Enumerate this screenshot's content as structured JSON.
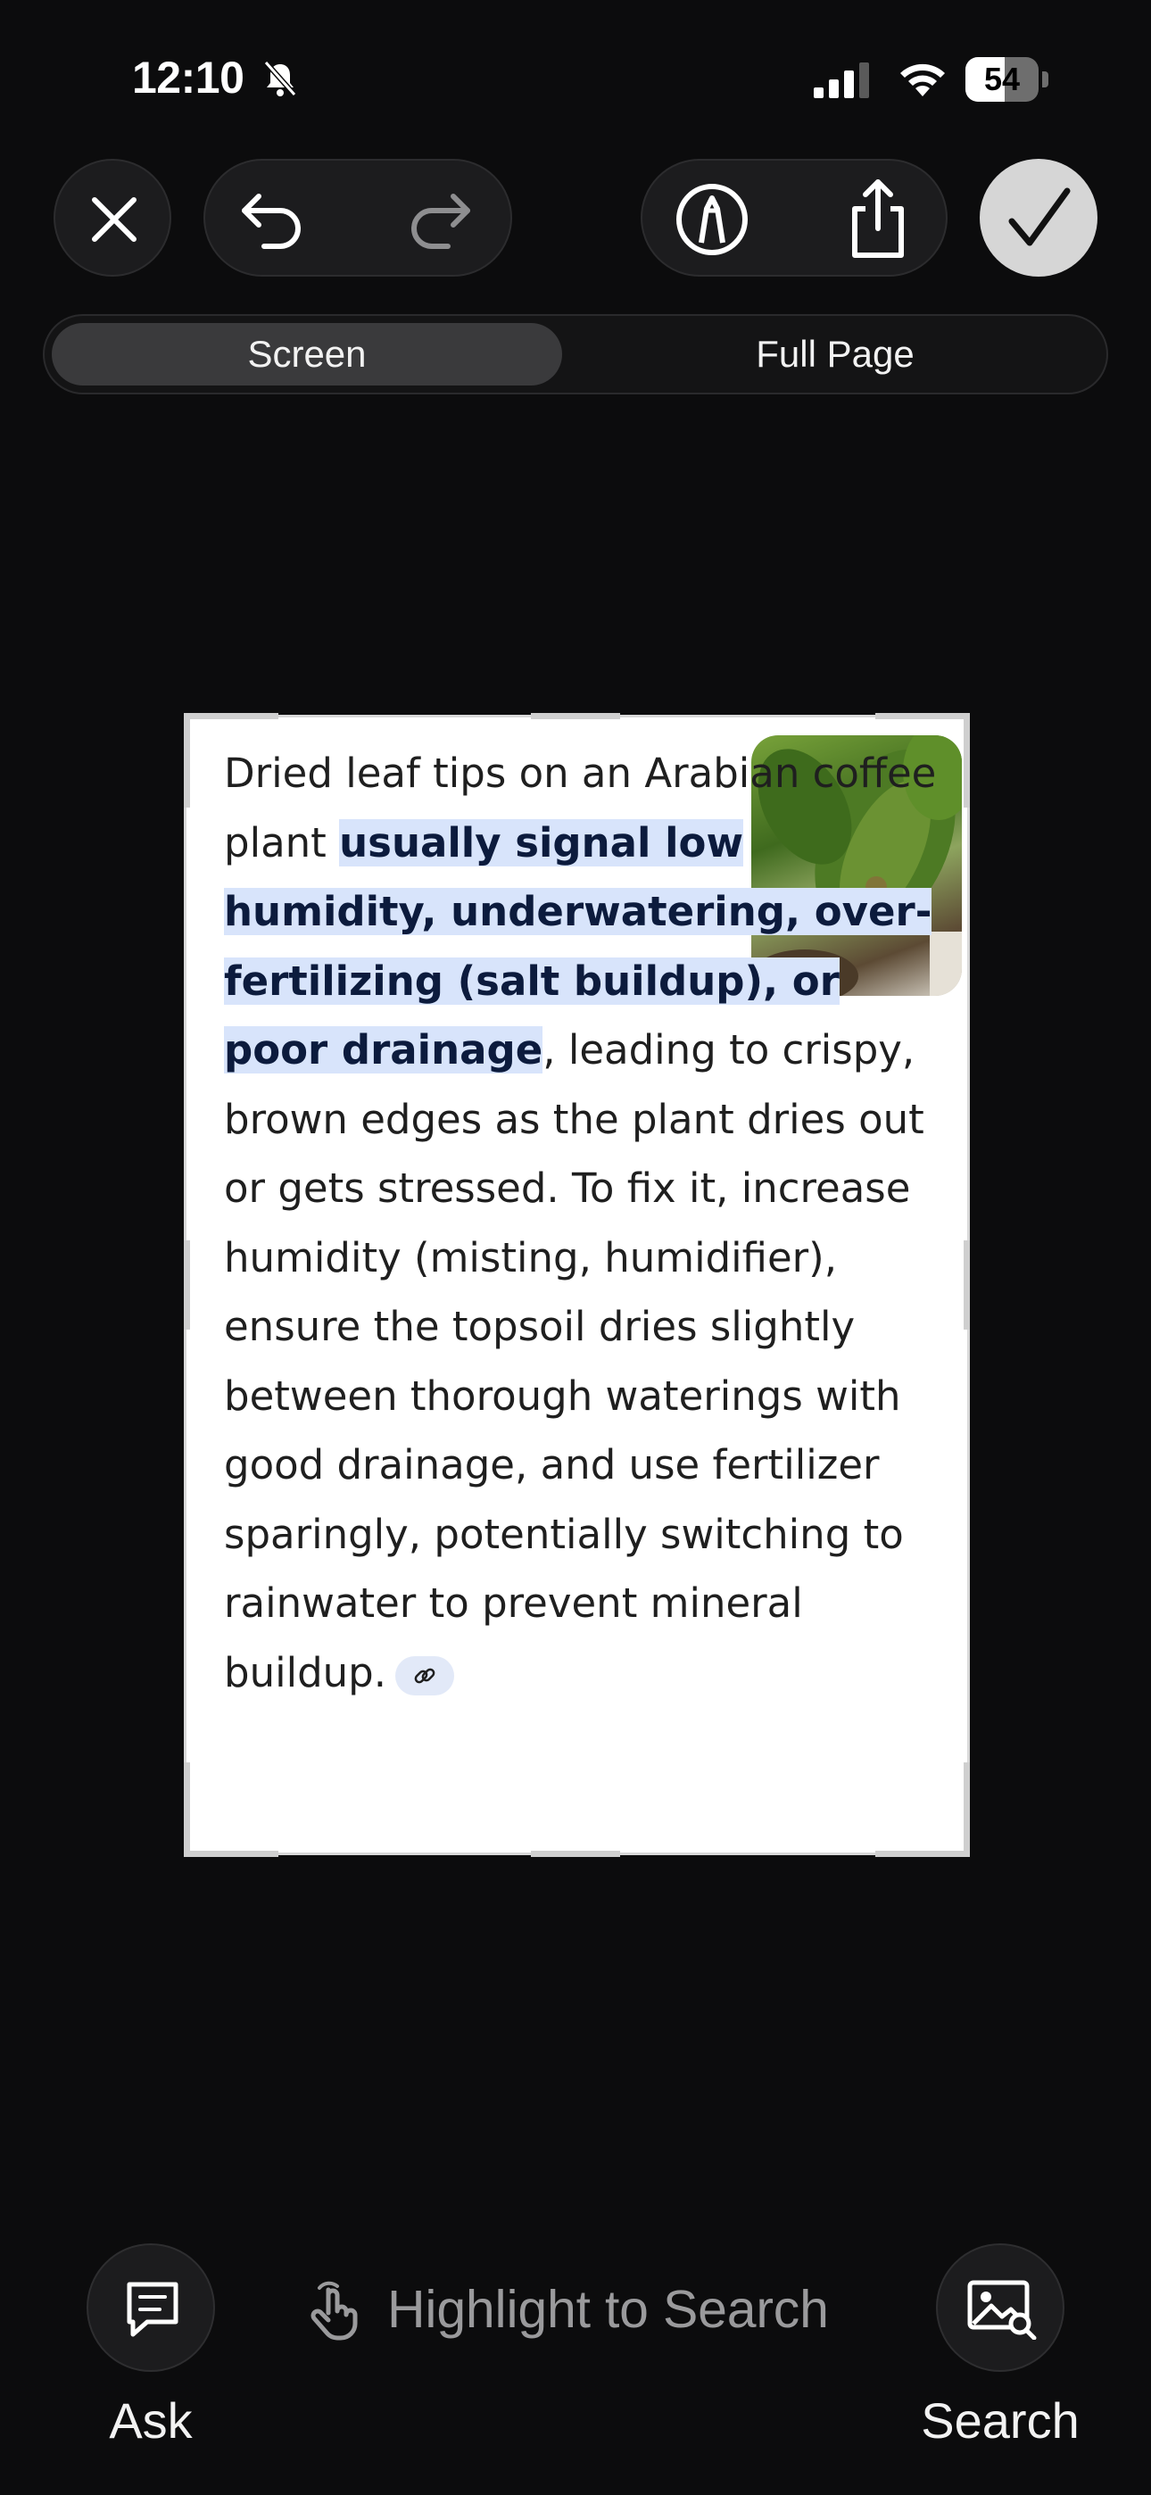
{
  "status_bar": {
    "time": "12:10",
    "battery_percent": "54",
    "battery_level": 0.54
  },
  "toolbar": {
    "close_icon": "close-icon",
    "undo_icon": "undo-icon",
    "redo_icon": "redo-icon",
    "markup_icon": "markup-pen-icon",
    "share_icon": "share-icon",
    "done_icon": "checkmark-icon"
  },
  "segmented": {
    "screen_label": "Screen",
    "full_page_label": "Full Page",
    "selected": "Screen"
  },
  "capture": {
    "text_lead": "Dried leaf tips on an Arabian coffee plant ",
    "text_highlight": "usually signal low humidity, underwatering, over-fertilizing (salt buildup), or poor drainage",
    "text_rest": ", leading to crispy, brown edges as the plant dries out or gets stressed. To fix it, increase humidity (misting, humidifier), ensure the topsoil dries slightly between thorough waterings with good drainage, and use fertilizer sparingly, potentially switching to rainwater to prevent mineral buildup.",
    "link_icon": "link-icon"
  },
  "bottom": {
    "ask_label": "Ask",
    "hint": "Highlight to Search",
    "search_label": "Search"
  }
}
